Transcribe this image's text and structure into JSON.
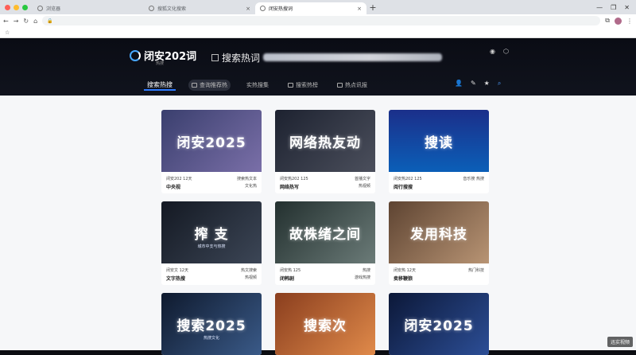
{
  "browser": {
    "tabs": [
      {
        "label": "浏览器",
        "active": false
      },
      {
        "label": "搜狐文化搜索",
        "active": false
      },
      {
        "label": "闭安热搜词",
        "active": true
      }
    ],
    "new_tab": "+",
    "url": "",
    "bookmark_items": [
      "",
      "",
      "",
      ""
    ]
  },
  "site": {
    "logo": "闭安202词",
    "logo_sub": "热搜",
    "hot_label": "搜索热词",
    "nav": [
      {
        "label": "搜索热搜",
        "active": true
      },
      {
        "label": "查询推荐热",
        "pill": true
      },
      {
        "label": "实热搜集"
      },
      {
        "label": "搜索热榜"
      },
      {
        "label": "热点讯报"
      }
    ]
  },
  "cards": [
    {
      "title": "闭安2025",
      "sub": "",
      "bg": "#3a3f6e",
      "m1": "闭安202 12天",
      "m2": "搜索热文本",
      "s1": "中央视",
      "s2": "文化热",
      "t1": "",
      "t2": ""
    },
    {
      "title": "网络热友动",
      "sub": "",
      "bg": "#2b2f3d",
      "m1": "闭安热202 125",
      "m2": "首播文字",
      "s1": "网络热写",
      "s2": "热视频",
      "t1": "",
      "t2": ""
    },
    {
      "title": "搜读",
      "sub": "",
      "bg": "#16307a",
      "m1": "闭安热202 125",
      "m2": "音乐搜 热搜",
      "s1": "阅行搜搜",
      "s2": "",
      "t1": "",
      "t2": ""
    },
    {
      "title": "搾 支",
      "sub": "城市中支与热搜",
      "bg": "#1d2430",
      "m1": "闭安文 12天",
      "m2": "热文搜索",
      "s1": "文字热搜",
      "s2": "热视频",
      "t1": "",
      "t2": ""
    },
    {
      "title": "故株绪之间",
      "sub": "",
      "bg": "#2d3b3e",
      "m1": "闭安热 125",
      "m2": "热搜",
      "s1": "闭韩剧",
      "s2": "游戏热搜",
      "t1": "",
      "t2": ""
    },
    {
      "title": "发用科技",
      "sub": "",
      "bg": "#7a5e45",
      "m1": "闭安热 12天",
      "m2": "热门科技",
      "s1": "卖移鞭狼",
      "s2": "",
      "t1": "",
      "t2": ""
    },
    {
      "title": "搜索2025",
      "sub": "热搜文化",
      "bg": "#1b2a44",
      "m1": "",
      "m2": "",
      "s1": "",
      "s2": "",
      "t1": "",
      "t2": ""
    },
    {
      "title": "搜索次",
      "sub": "",
      "bg": "#b05a2a",
      "m1": "",
      "m2": "",
      "s1": "",
      "s2": "",
      "t1": "",
      "t2": ""
    },
    {
      "title": "闭安2025",
      "sub": "",
      "bg": "#13224d",
      "m1": "",
      "m2": "",
      "s1": "",
      "s2": "",
      "t1": "",
      "t2": ""
    }
  ],
  "watermark": "迅实视频",
  "colors": {
    "accent": "#2f7bff",
    "header_bg": "#0a0c14"
  }
}
